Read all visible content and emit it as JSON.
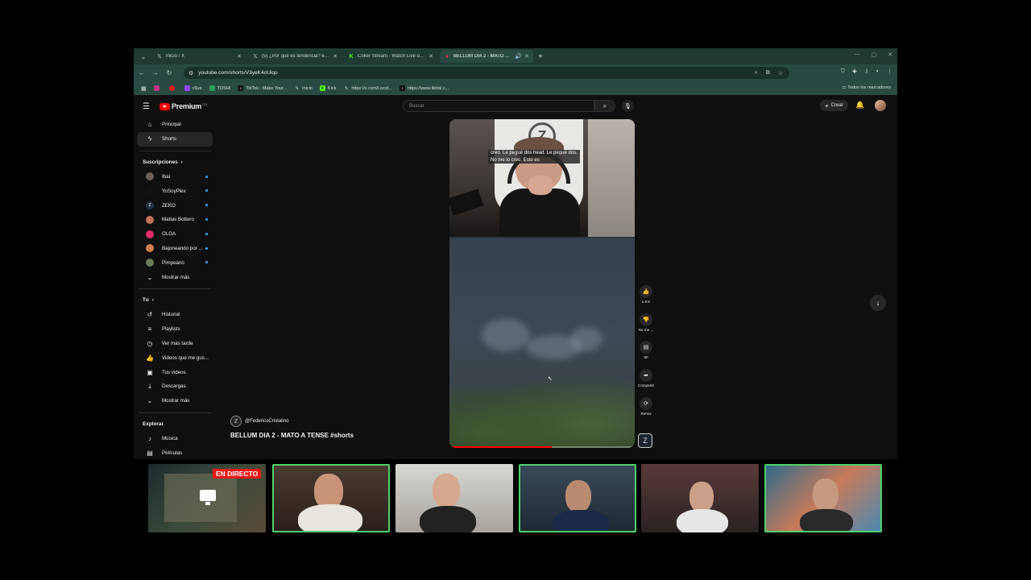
{
  "browser": {
    "tabs": [
      {
        "icon": "x-logo-icon",
        "title": "Inicio / X",
        "active": false
      },
      {
        "icon": "x-logo-icon",
        "title": "(5) ¿Por qué es tendencia? en X",
        "active": false
      },
      {
        "icon": "kick-logo-icon",
        "title": "Coker Stream - Watch Live on K",
        "active": false
      },
      {
        "icon": "youtube-logo-icon",
        "title": "BELLUM DIA 2 - MATO A TE",
        "active": true
      }
    ],
    "url": "youtube.com/shorts/V3yeK4oUiqo",
    "bookmarks": [
      "c9ue",
      "TOSHI",
      "TikTok - Make Your...",
      "Inicio",
      "Kick",
      "https://x.com/Locst...",
      "https://www.tiktok.c..."
    ],
    "all_bookmarks": "Todos los marcadores"
  },
  "youtube": {
    "logo_word": "Premium",
    "logo_superscript": "CO",
    "search_placeholder": "Buscar",
    "create_label": "Crear",
    "sidebar": {
      "main": [
        {
          "icon": "home-icon",
          "label": "Principal"
        },
        {
          "icon": "shorts-icon",
          "label": "Shorts",
          "active": true
        }
      ],
      "subscriptions_title": "Suscripciones",
      "subscriptions": [
        {
          "label": "Ibai",
          "color": "#6a5e58"
        },
        {
          "label": "YoSoyPlex",
          "color": "#111111"
        },
        {
          "label": "ZEKO",
          "color": "#223344"
        },
        {
          "label": "Matias Bottero",
          "color": "#c0705a"
        },
        {
          "label": "OLGA",
          "color": "#e0306a"
        },
        {
          "label": "Bajoneando por ...",
          "color": "#d08050"
        },
        {
          "label": "Pimpeano",
          "color": "#6a7a5a"
        }
      ],
      "show_more": "Mostrar más",
      "you_title": "Tú",
      "you": [
        {
          "icon": "history-icon",
          "label": "Historial"
        },
        {
          "icon": "playlist-icon",
          "label": "Playlists"
        },
        {
          "icon": "clock-icon",
          "label": "Ver más tarde"
        },
        {
          "icon": "thumbs-up-icon",
          "label": "Videos que me gus..."
        },
        {
          "icon": "your-videos-icon",
          "label": "Tus videos"
        },
        {
          "icon": "download-icon",
          "label": "Descargas"
        }
      ],
      "show_more_2": "Mostrar más",
      "explore_title": "Explorar",
      "explore": [
        {
          "icon": "music-icon",
          "label": "Música"
        },
        {
          "icon": "film-icon",
          "label": "Películas"
        }
      ]
    },
    "short": {
      "caption_line1": "creo. Le pegué dos head. Le pegué dos.",
      "caption_line2": "No me lo creo. Esto es",
      "channel": "@FedericoCristalino",
      "title": "BELLUM DIA 2 - MATO A TENSE #shorts",
      "progress_fraction": 0.55,
      "actions": [
        {
          "icon": "like-icon",
          "label": "1.9 K"
        },
        {
          "icon": "dislike-icon",
          "label": "No me ..."
        },
        {
          "icon": "comment-icon",
          "label": "50"
        },
        {
          "icon": "share-icon",
          "label": "Compartir"
        },
        {
          "icon": "remix-icon",
          "label": "Remix"
        }
      ]
    }
  },
  "stream_overlay": {
    "live_badge": "EN DIRECTO"
  }
}
